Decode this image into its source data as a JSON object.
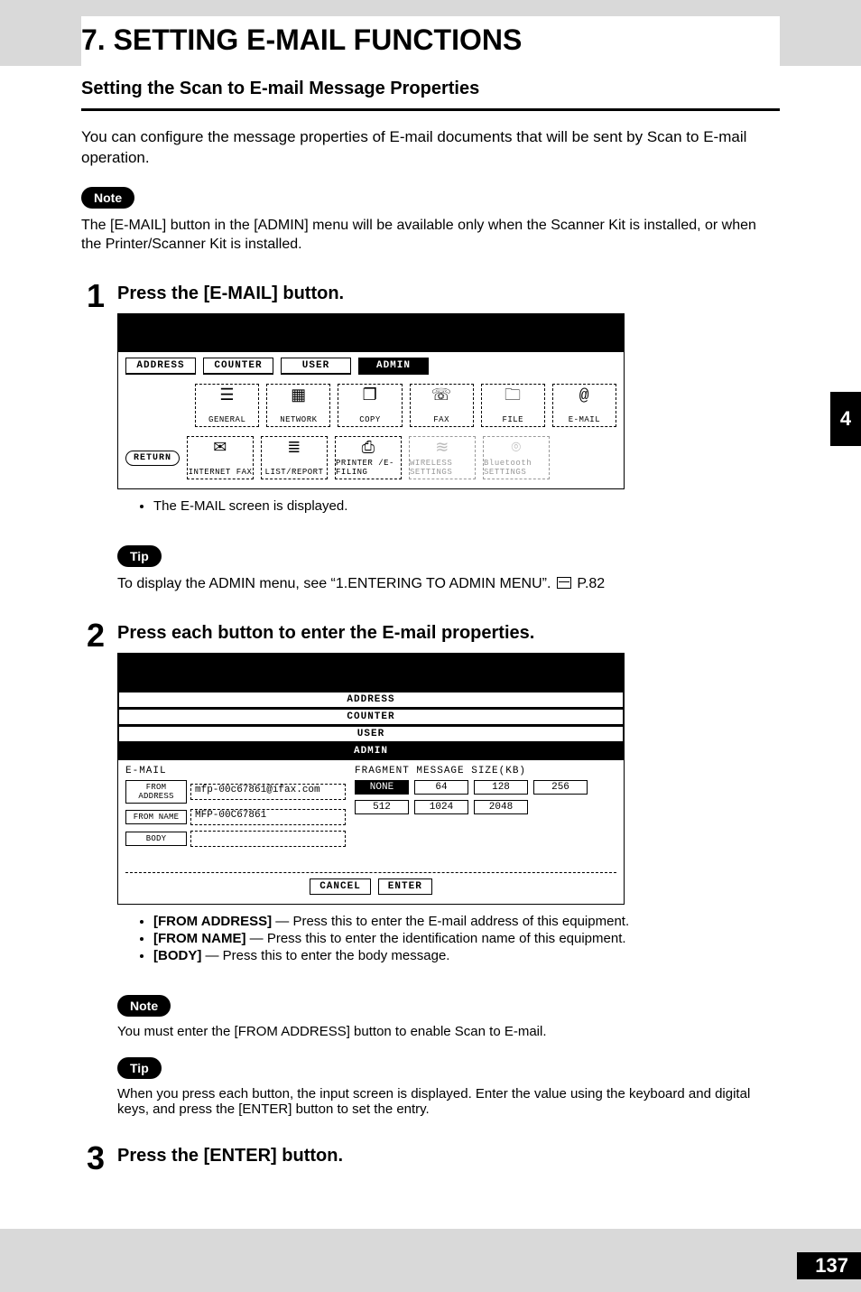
{
  "chapter": {
    "title": "7. SETTING E-MAIL FUNCTIONS"
  },
  "section": {
    "title": "Setting the Scan to E-mail Message Properties"
  },
  "intro": "You can configure the message properties of E-mail documents that will be sent by Scan to E-mail operation.",
  "note1": {
    "label": "Note",
    "text": "The [E-MAIL] button in the [ADMIN] menu will be available only when the Scanner Kit is installed, or when the Printer/Scanner Kit is installed."
  },
  "step1": {
    "num": "1",
    "heading": "Press the [E-MAIL] button.",
    "bullet": "The E-MAIL screen is displayed."
  },
  "screen1": {
    "tabs": [
      "ADDRESS",
      "COUNTER",
      "USER",
      "ADMIN"
    ],
    "selected_tab": "ADMIN",
    "row1": [
      {
        "label": "GENERAL",
        "glyph": "☰"
      },
      {
        "label": "NETWORK",
        "glyph": "▦"
      },
      {
        "label": "COPY",
        "glyph": "❐"
      },
      {
        "label": "FAX",
        "glyph": "☏"
      },
      {
        "label": "FILE",
        "glyph": "🗀"
      },
      {
        "label": "E-MAIL",
        "glyph": "@"
      }
    ],
    "row2": [
      {
        "label": "RETURN",
        "type": "return"
      },
      {
        "label": "INTERNET FAX",
        "glyph": "✉"
      },
      {
        "label": "LIST/REPORT",
        "glyph": "≣"
      },
      {
        "label": "PRINTER /E-FILING",
        "glyph": "⎙"
      },
      {
        "label": "WIRELESS SETTINGS",
        "glyph": "≋",
        "dim": true
      },
      {
        "label": "Bluetooth SETTINGS",
        "glyph": "⌾",
        "dim": true
      }
    ]
  },
  "tip1": {
    "label": "Tip",
    "text_a": "To display the ADMIN menu, see “1.ENTERING TO ADMIN MENU”.",
    "text_b": "P.82"
  },
  "step2": {
    "num": "2",
    "heading": "Press each button to enter the E-mail properties."
  },
  "screen2": {
    "tabs": [
      "ADDRESS",
      "COUNTER",
      "USER",
      "ADMIN"
    ],
    "selected_tab": "ADMIN",
    "title_left": "E-MAIL",
    "title_right": "FRAGMENT MESSAGE SIZE(KB)",
    "fields": {
      "from_address": {
        "btn": "FROM ADDRESS",
        "val": "mfp-00c67861@ifax.com"
      },
      "from_name": {
        "btn": "FROM NAME",
        "val": "MFP-00C67861"
      },
      "body": {
        "btn": "BODY",
        "val": ""
      }
    },
    "sizes": [
      "NONE",
      "64",
      "128",
      "256",
      "512",
      "1024",
      "2048"
    ],
    "selected_size": "NONE",
    "footer": {
      "cancel": "CANCEL",
      "enter": "ENTER"
    }
  },
  "step2_bullets": [
    {
      "b": "[FROM ADDRESS]",
      "t": " — Press this to enter the E-mail address of this equipment."
    },
    {
      "b": "[FROM NAME]",
      "t": " — Press this to enter the identification name of this equipment."
    },
    {
      "b": "[BODY]",
      "t": " — Press this to enter the body message."
    }
  ],
  "note2": {
    "label": "Note",
    "text": "You must enter the [FROM ADDRESS] button to enable Scan to E-mail."
  },
  "tip2": {
    "label": "Tip",
    "text": "When you press each button, the input screen is displayed.  Enter the value using the keyboard and digital keys, and press the [ENTER] button to set the entry."
  },
  "step3": {
    "num": "3",
    "heading": "Press the [ENTER] button."
  },
  "side_tab": "4",
  "page_number": "137"
}
